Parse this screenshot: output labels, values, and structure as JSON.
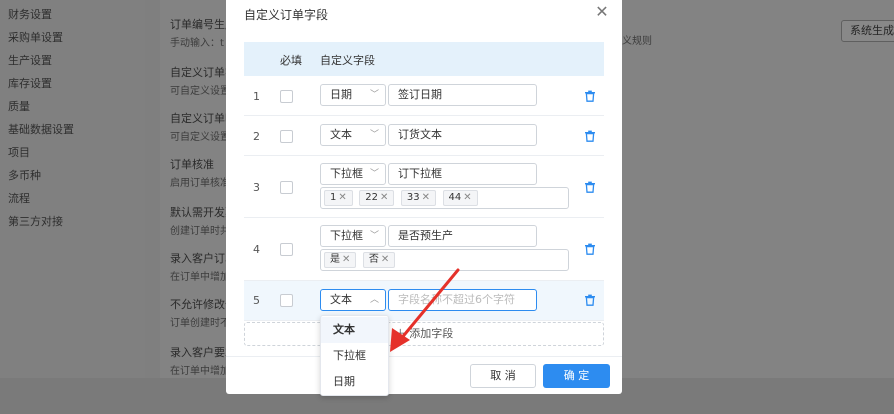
{
  "sidebar": {
    "items": [
      "财务设置",
      "采购单设置",
      "生产设置",
      "库存设置",
      "质量",
      "基础数据设置",
      "项目",
      "多币种",
      "流程",
      "第三方对接"
    ]
  },
  "background": {
    "rows": [
      {
        "title": "订单编号生成",
        "desc": "手动输入：t"
      },
      {
        "title": "自定义订单字",
        "desc": "可自定义设置"
      },
      {
        "title": "自定义订单明",
        "desc": "可自定义设置"
      },
      {
        "title": "订单核准",
        "desc": "启用订单核准"
      },
      {
        "title": "默认需开发票",
        "desc": "创建订单时共"
      },
      {
        "title": "录入客户订单",
        "desc": "在订单中增加"
      },
      {
        "title": "不允许修改价",
        "desc": "订单创建时不"
      },
      {
        "title": "录入客户要求",
        "desc": "在订单中增加"
      }
    ],
    "right_text": "义规则",
    "right_button": "系统生成"
  },
  "modal": {
    "title": "自定义订单字段",
    "close_icon": "close-icon",
    "columns": {
      "required": "必填",
      "field": "自定义字段"
    },
    "rows": [
      {
        "index": "1",
        "type": "日期",
        "name": "签订日期",
        "tags": []
      },
      {
        "index": "2",
        "type": "文本",
        "name": "订货文本",
        "tags": []
      },
      {
        "index": "3",
        "type": "下拉框",
        "name": "订下拉框",
        "tags": [
          "1",
          "22",
          "33",
          "44"
        ]
      },
      {
        "index": "4",
        "type": "下拉框",
        "name": "是否预生产",
        "tags": [
          "是",
          "否"
        ]
      },
      {
        "index": "5",
        "type": "文本",
        "name": "",
        "placeholder": "字段名称不超过6个字符",
        "tags": []
      }
    ],
    "add_label": "添加字段",
    "cancel_label": "取 消",
    "ok_label": "确 定",
    "accent_color": "#2d8cf0"
  },
  "dropdown": {
    "options": [
      "文本",
      "下拉框",
      "日期"
    ],
    "selected": "文本"
  },
  "annotation": {
    "arrow_color": "#e5312a"
  }
}
